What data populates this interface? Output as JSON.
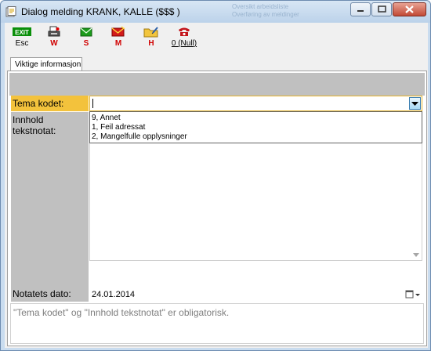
{
  "window": {
    "title": "Dialog melding KRANK, KALLE ($$$ )",
    "background_ghost_lines": [
      "Oversikt arbeidsliste",
      "Overføring av meldinger"
    ],
    "controls": [
      "minimize-icon",
      "maximize-icon",
      "close-icon"
    ]
  },
  "toolbar": {
    "items": [
      {
        "icon_text": "EXIT",
        "icon": "exit-icon",
        "label": "Esc"
      },
      {
        "icon": "print-document-icon",
        "label": "W"
      },
      {
        "icon": "envelope-icon",
        "label": "S"
      },
      {
        "icon": "red-mail-icon",
        "label": "M"
      },
      {
        "icon": "folder-edit-icon",
        "label": "H"
      },
      {
        "icon": "telephone-icon",
        "label": "0 (Null)"
      }
    ]
  },
  "tabs": [
    {
      "label": "Viktige informasjon"
    }
  ],
  "form": {
    "tema_label": "Tema kodet:",
    "tema_value": "",
    "tema_options": [
      "9, Annet",
      "1, Feil adressat",
      "2, Mangelfulle opplysninger"
    ],
    "innhold_label": "Innhold tekstnotat:",
    "innhold_value": "",
    "dato_label": "Notatets dato:",
    "dato_value": "24.01.2014"
  },
  "message": "\"Tema kodet\" og \"Innhold tekstnotat\" er obligatorisk.",
  "colors": {
    "highlight_label": "#f3c23c",
    "red_label": "#d00000",
    "panel_gray": "#c0c0c0"
  }
}
